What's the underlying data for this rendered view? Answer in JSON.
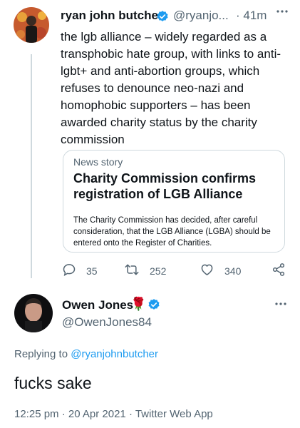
{
  "parent_tweet": {
    "author_name": "ryan john butcher",
    "author_handle": "@ryanjo...",
    "time_ago": "· 41m",
    "more_icon": "more-horizontal-icon",
    "text": "the lgb alliance – widely regarded as a transphobic hate group, with links to anti-lgbt+ and anti-abortion groups, which refuses to denounce neo-nazi and homophobic supporters – has been awarded charity status by the charity commission",
    "card": {
      "kicker": "News story",
      "title": "Charity Commission confirms registration of LGB Alliance",
      "description": "The Charity Commission has decided, after careful consideration, that the LGB Alliance (LGBA) should be entered onto the Register of Charities."
    },
    "actions": {
      "reply_count": "35",
      "retweet_count": "252",
      "like_count": "340"
    }
  },
  "main_tweet": {
    "author_name": "Owen Jones",
    "author_emoji": "🌹",
    "author_handle": "@OwenJones84",
    "replying_prefix": "Replying to",
    "replying_to": "@ryanjohnbutcher",
    "text": "fucks sake",
    "meta": "12:25 pm · 20 Apr 2021 · Twitter Web App"
  },
  "colors": {
    "accent": "#1d9bf0",
    "secondary_text": "#536471",
    "border": "#cfd9de"
  }
}
